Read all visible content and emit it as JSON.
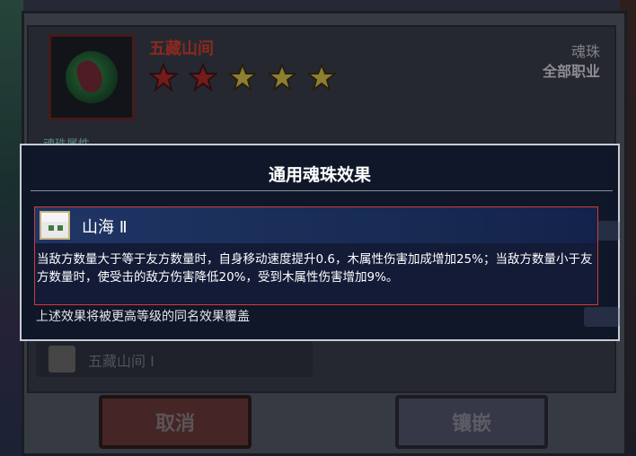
{
  "background": {
    "item_name": "五藏山间",
    "star_count": 5,
    "star_colors": [
      "#b32a2a",
      "#b32a2a",
      "#d9c24a",
      "#d9c24a",
      "#d9c24a"
    ],
    "item_type": "魂珠",
    "item_class": "全部职业",
    "attr_title": "魂珠属性",
    "socket_name": "五藏山间 Ⅰ",
    "cancel_label": "取消",
    "inlay_label": "镶嵌"
  },
  "modal": {
    "title": "通用魂珠效果",
    "effect": {
      "name": "山海 Ⅱ",
      "description": "当敌方数量大于等于友方数量时，自身移动速度提升0.6，木属性伤害加成增加25%；当敌方数量小于友方数量时，使受击的敌方伤害降低20%，受到木属性伤害增加9%。"
    },
    "footer": "上述效果将被更高等级的同名效果覆盖"
  },
  "colors": {
    "highlight_border": "#d23a3a",
    "item_name": "#d6402f",
    "modal_border": "#c9ccd4"
  }
}
